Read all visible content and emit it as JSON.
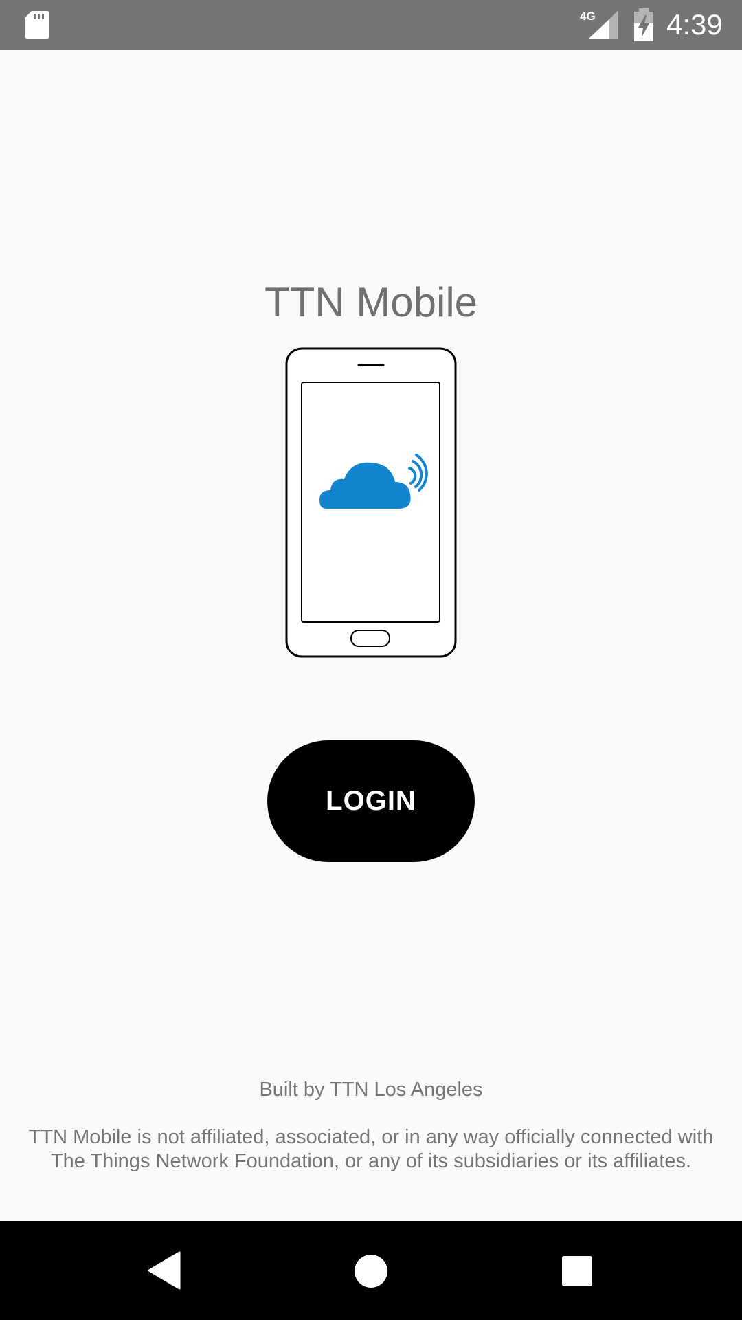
{
  "status_bar": {
    "time": "4:39",
    "network_label": "4G",
    "icons": [
      "sd-card-icon",
      "cellular-signal-icon",
      "battery-charging-icon"
    ],
    "background_color": "#757575"
  },
  "app": {
    "title": "TTN Mobile",
    "illustration_icon": "phone-with-cloud-icon",
    "cloud_color": "#1385cf",
    "login_label": "LOGIN",
    "login_button_color": "#000000",
    "built_by": "Built by TTN Los Angeles",
    "disclaimer": "TTN Mobile is not affiliated, associated, or in any way officially connected with The Things Network Foundation, or any of its subsidiaries or its affiliates."
  },
  "nav_bar": {
    "icons": [
      "back-icon",
      "home-icon",
      "recents-icon"
    ]
  }
}
